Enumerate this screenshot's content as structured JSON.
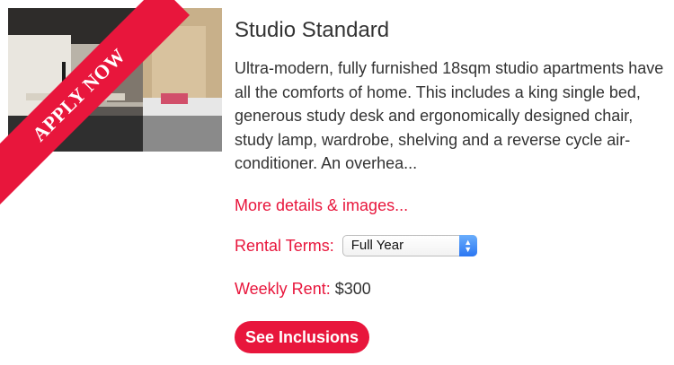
{
  "ribbon": {
    "label": "APPLY NOW"
  },
  "room": {
    "title": "Studio Standard",
    "description": "Ultra-modern, fully furnished 18sqm studio apartments have all the comforts of home. This includes a king single bed, generous study desk and ergonomically designed chair, study lamp, wardrobe, shelving and a reverse cycle air-conditioner. An overhea...",
    "more_link": "More details & images..."
  },
  "rental_terms": {
    "label": "Rental Terms:",
    "selected": "Full Year"
  },
  "weekly_rent": {
    "label": "Weekly Rent:",
    "value": "$300"
  },
  "inclusions_button": "See Inclusions",
  "colors": {
    "accent": "#e8163c",
    "text": "#333333"
  },
  "icons": {
    "select_arrows": "chevron-up-down-icon"
  }
}
